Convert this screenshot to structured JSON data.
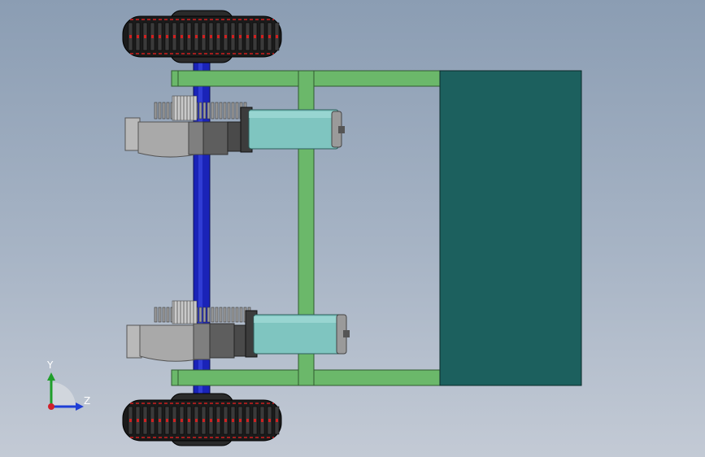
{
  "viewport": {
    "title": "",
    "background_top": "#8b9db3",
    "background_bottom": "#c3cad5"
  },
  "model": {
    "frame_color": "#6bb86a",
    "frame_edge": "#2f5a2f",
    "panel_color": "#1c605e",
    "axle_color": "#1a23b8",
    "tire_color": "#1b1b1b",
    "tire_accent": "#d02020",
    "motor_color": "#7fc5c0",
    "gearbox_color": "#8f8f8f"
  },
  "triad": {
    "y_label": "Y",
    "z_label": "Z",
    "y_color": "#1f9e2a",
    "z_color": "#1f3ed6",
    "origin_color": "#d0202a",
    "icon": "coordinate-triad-icon"
  }
}
